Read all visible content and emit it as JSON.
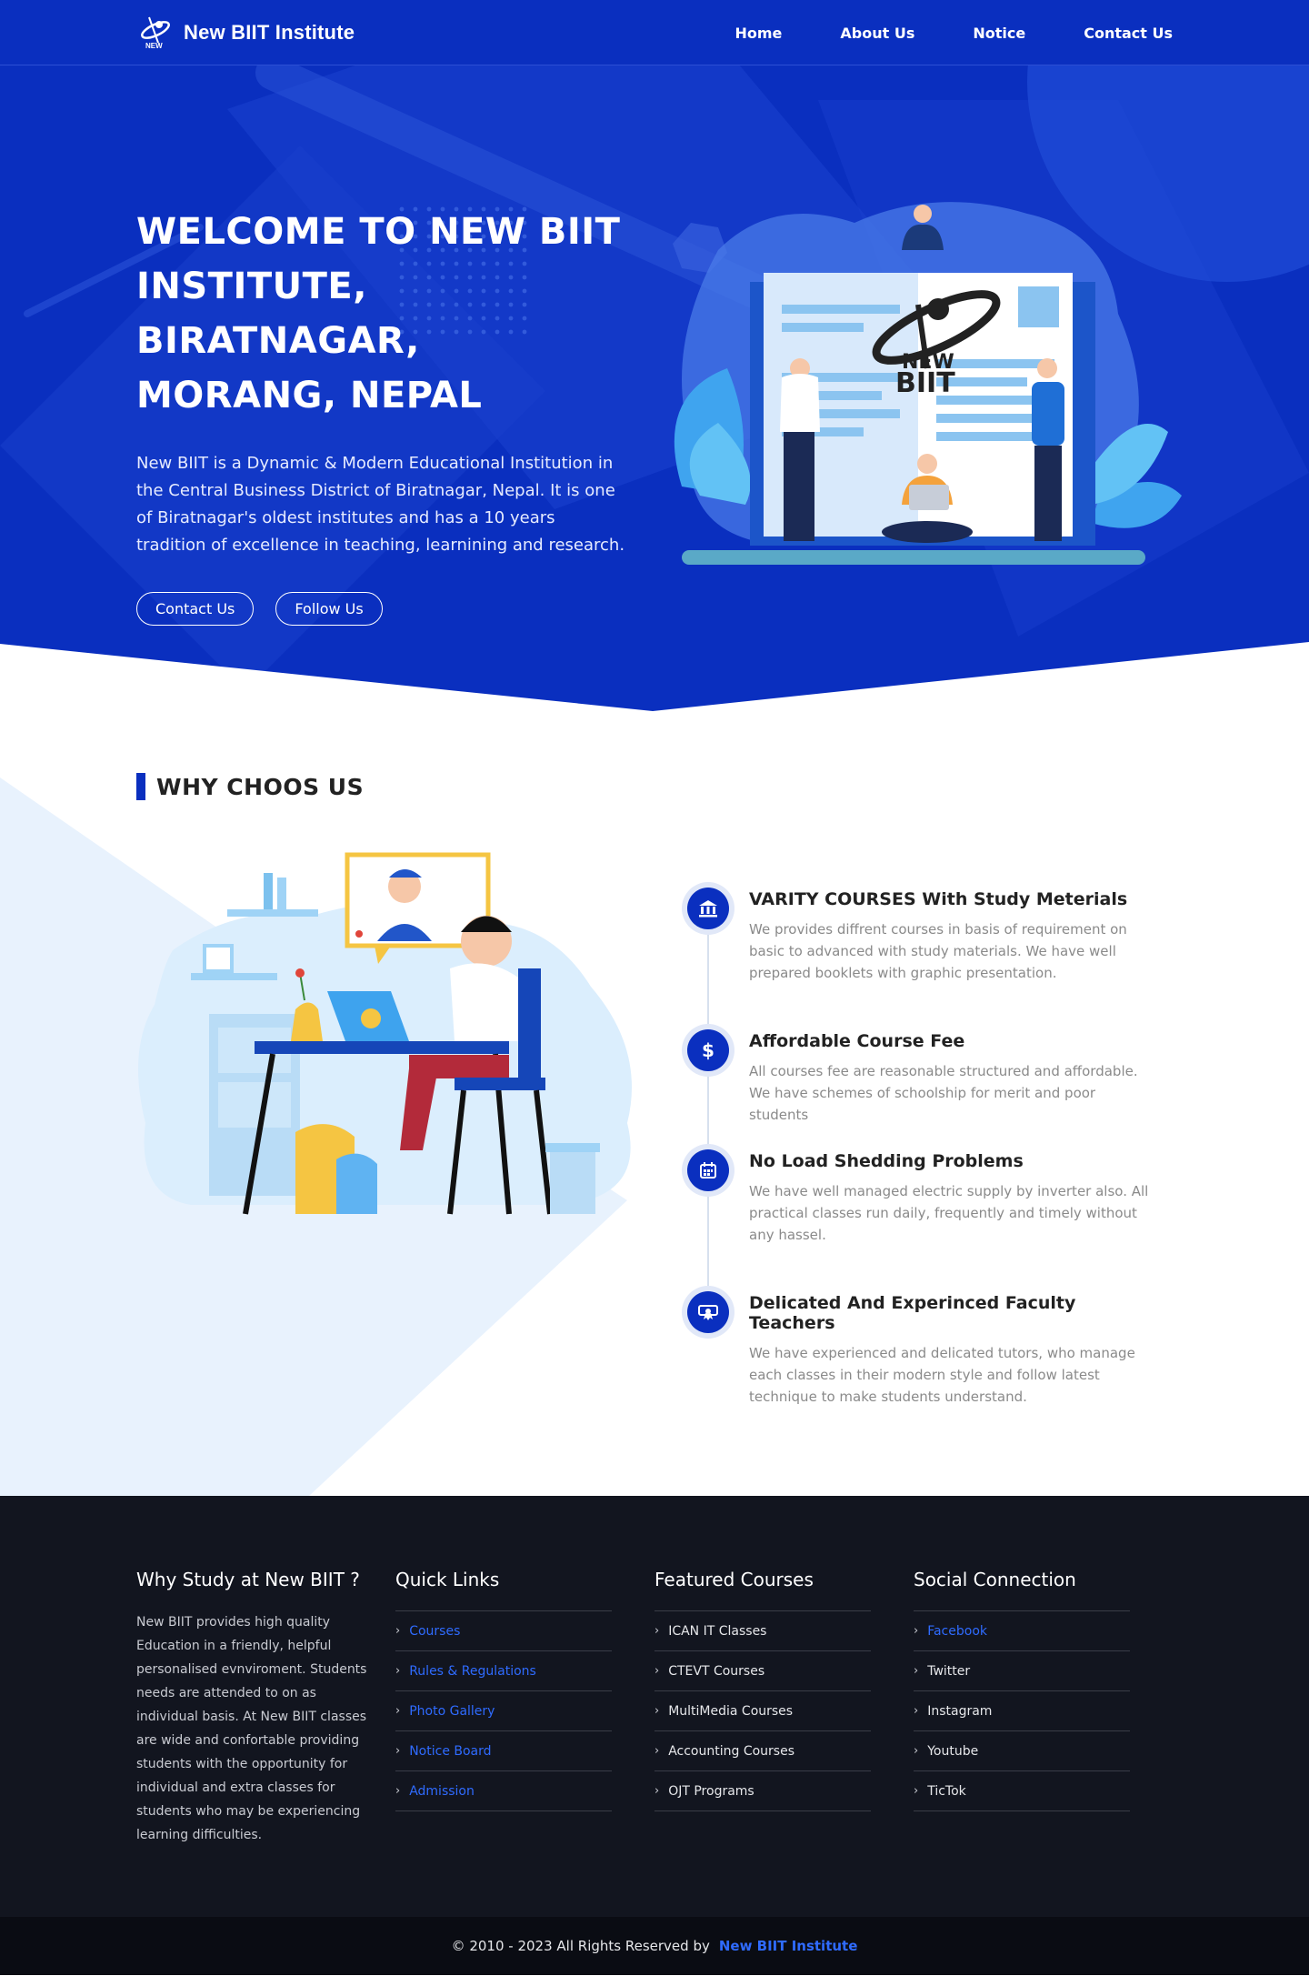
{
  "navbar": {
    "brand": "New BIIT Institute",
    "links": [
      "Home",
      "About Us",
      "Notice",
      "Contact Us"
    ]
  },
  "hero": {
    "title_lines": [
      "WELCOME TO NEW BIIT",
      "INSTITUTE, BIRATNAGAR,",
      "MORANG, NEPAL"
    ],
    "description": "New BIIT is a Dynamic & Modern Educational Institution in the Central Business District of Biratnagar, Nepal. It is one of Biratnagar's oldest institutes and has a 10 years tradition of excellence in teaching, learnining and research.",
    "buttons": [
      "Contact Us",
      "Follow Us"
    ],
    "book_logo_text": [
      "NEW",
      "BIIT"
    ]
  },
  "why": {
    "title": "WHY CHOOS US",
    "features": [
      {
        "icon": "bank-icon",
        "title": "VARITY COURSES With Study Meterials",
        "text": "We provides diffrent courses in basis of requirement on basic to advanced with study materials. We have well prepared booklets with graphic presentation."
      },
      {
        "icon": "dollar-icon",
        "title": "Affordable Course Fee",
        "text": "All courses fee are reasonable structured and affordable. We have schemes of schoolship for merit and poor students"
      },
      {
        "icon": "calendar-icon",
        "title": "No Load Shedding Problems",
        "text": "We have well managed electric supply by inverter also. All practical classes run daily, frequently and timely without any hassel."
      },
      {
        "icon": "certificate-icon",
        "title": "Delicated And Experinced Faculty Teachers",
        "text": "We have experienced and delicated tutors, who manage each classes in their modern style and follow latest technique to make students understand."
      }
    ]
  },
  "footer": {
    "about": {
      "heading": "Why Study at New BIIT ?",
      "text": "New BIIT provides high quality Education in a friendly, helpful personalised evnviroment. Students needs are attended to on as individual basis. At New BIIT classes are wide and confortable providing students with the opportunity for individual and extra classes for students who may be experiencing learning difficulties."
    },
    "quick_links": {
      "heading": "Quick Links",
      "items": [
        "Courses",
        "Rules & Regulations",
        "Photo Gallery",
        "Notice Board",
        "Admission"
      ]
    },
    "featured_courses": {
      "heading": "Featured Courses",
      "items": [
        "ICAN IT Classes",
        "CTEVT Courses",
        "MultiMedia Courses",
        "Accounting Courses",
        "OJT Programs"
      ]
    },
    "social": {
      "heading": "Social Connection",
      "items": [
        "Facebook",
        "Twitter",
        "Instagram",
        "Youtube",
        "TicTok"
      ]
    },
    "copyright": "© 2010 - 2023 All Rights Reserved by",
    "copyright_brand": "New BIIT Institute"
  },
  "colors": {
    "primary": "#0a2fbf",
    "footer_bg": "#12151f",
    "link_blue": "#2f6bff"
  }
}
